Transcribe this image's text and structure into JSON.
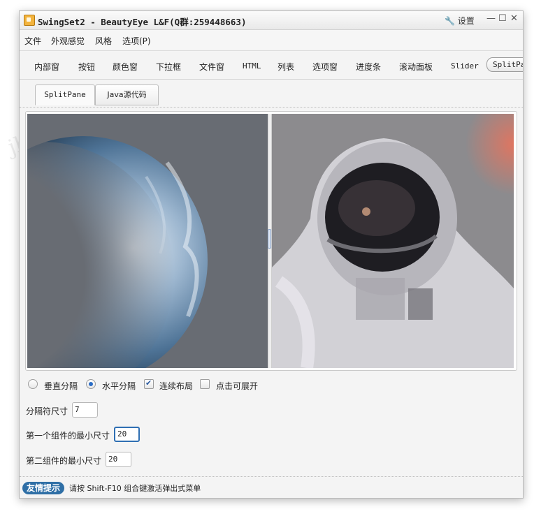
{
  "window": {
    "title": "SwingSet2 - BeautyEye L&F(Q群:259448663)",
    "settings_label": "设置",
    "controls": {
      "minimize": "—",
      "maximize": "☐",
      "close": "✕"
    }
  },
  "menubar": {
    "items": [
      "文件",
      "外观感觉",
      "风格",
      "选项(P)"
    ]
  },
  "demo_tabs": {
    "items": [
      "内部窗",
      "按钮",
      "颜色窗",
      "下拉框",
      "文件窗",
      "HTML",
      "列表",
      "选项窗",
      "进度条",
      "滚动面板",
      "Slider",
      "SplitPa"
    ],
    "selected": "SplitPa"
  },
  "sub_tabs": {
    "items": [
      "SplitPane",
      "Java源代码"
    ],
    "selected": "SplitPane"
  },
  "options": {
    "vertical_split": "垂直分隔",
    "horizontal_split": "水平分隔",
    "continuous_layout": "连续布局",
    "one_touch_expandable": "点击可展开",
    "vertical_checked": false,
    "horizontal_checked": true,
    "continuous_checked": true,
    "expandable_checked": false
  },
  "fields": {
    "divider_size_label": "分隔符尺寸",
    "divider_size_value": "7",
    "first_min_label": "第一个组件的最小尺寸",
    "first_min_value": "20",
    "second_min_label": "第二组件的最小尺寸",
    "second_min_value": "20"
  },
  "status": {
    "badge": "友情提示",
    "text": "请按 Shift-F10 组合键激活弹出式菜单"
  },
  "watermark": "jb2011@163.com",
  "colors": {
    "accent": "#2f6fa6",
    "focus": "#2f6fb3"
  }
}
